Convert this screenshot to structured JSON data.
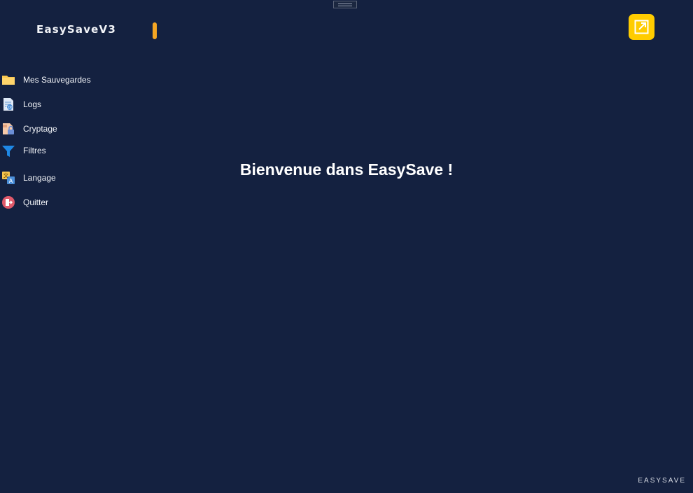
{
  "app": {
    "title": "EasySaveV3",
    "footer": "EASYSAVE"
  },
  "header": {
    "open_icon": "open-external-icon",
    "accent_color": "#ffcc00"
  },
  "sidebar": {
    "items": [
      {
        "label": "Mes Sauvegardes",
        "icon": "folder-icon"
      },
      {
        "label": "Logs",
        "icon": "logs-icon"
      },
      {
        "label": "Cryptage",
        "icon": "encryption-icon"
      },
      {
        "label": "Filtres",
        "icon": "filter-icon"
      },
      {
        "label": "Langage",
        "icon": "language-icon"
      },
      {
        "label": "Quitter",
        "icon": "quit-icon"
      }
    ]
  },
  "main": {
    "welcome": "Bienvenue dans EasySave !"
  },
  "colors": {
    "background": "#142140",
    "brand_accent": "#f5a623",
    "button": "#ffcc00"
  }
}
